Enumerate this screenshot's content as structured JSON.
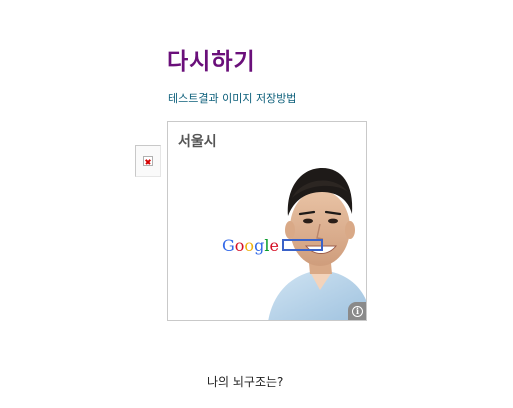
{
  "header": {
    "retry_label": "다시하기",
    "save_link_label": "테스트결과 이미지 저장방법"
  },
  "ad": {
    "city_label": "서울시",
    "google_logo_letters": [
      {
        "char": "G",
        "color": "#3369e8"
      },
      {
        "char": "o",
        "color": "#d50f25"
      },
      {
        "char": "o",
        "color": "#eeb211"
      },
      {
        "char": "g",
        "color": "#3369e8"
      },
      {
        "char": "l",
        "color": "#009925"
      },
      {
        "char": "e",
        "color": "#d50f25"
      }
    ],
    "info_icon_glyph": "i",
    "info_icon": "info-icon",
    "search_box_color": "#3a62c8"
  },
  "broken_image_icon": "broken-image-icon",
  "footer": {
    "question_label": "나의 뇌구조는?"
  },
  "colors": {
    "title": "#6a0f7a",
    "link": "#0b5e7a"
  }
}
